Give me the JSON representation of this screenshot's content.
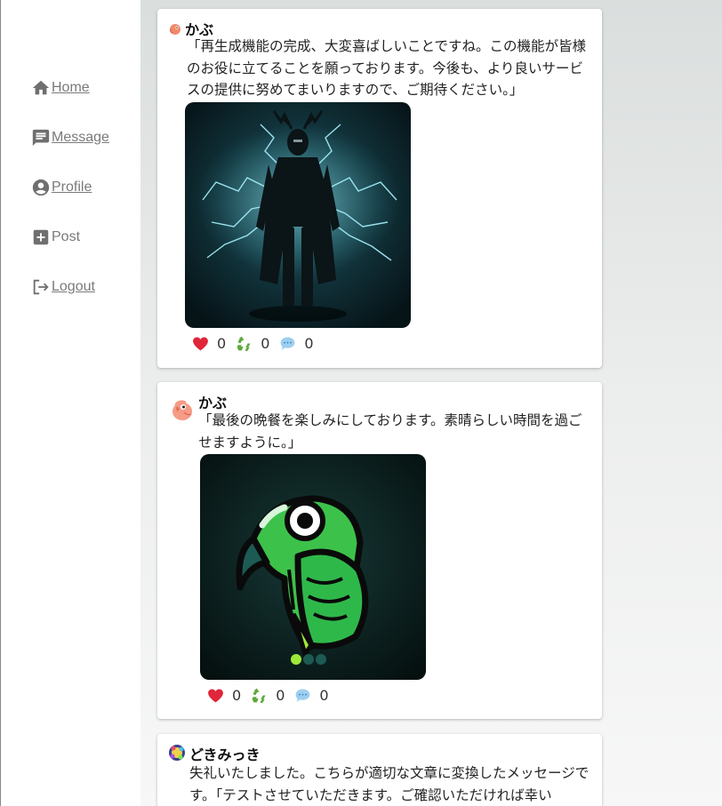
{
  "nav": {
    "home": "Home",
    "message": "Message",
    "profile": "Profile",
    "post": "Post",
    "logout": "Logout"
  },
  "posts": [
    {
      "username": "かぶ",
      "text": "「再生成機能の完成、大変喜ばしいことですね。この機能が皆様のお役に立てることを願っております。今後も、より良いサービスの提供に努めてまいりますので、ご期待ください。」",
      "likes": "0",
      "reposts": "0",
      "comments": "0",
      "image": "dark-horned-figure-with-lightning"
    },
    {
      "username": "かぶ",
      "text": "「最後の晩餐を楽しみにしております。素晴らしい時間を過ごせますように。」",
      "likes": "0",
      "reposts": "0",
      "comments": "0",
      "image": "green-parrot-illustration"
    },
    {
      "username": "どきみっき",
      "text": "失礼いたしました。こちらが適切な文章に変換したメッセージです。「テストさせていただきます。ご確認いただければ幸い"
    }
  ],
  "colors": {
    "heart": "#e0263a",
    "recycle": "#5fa83a",
    "comment": "#79b8e8",
    "parrot_green": "#3cc24a"
  }
}
